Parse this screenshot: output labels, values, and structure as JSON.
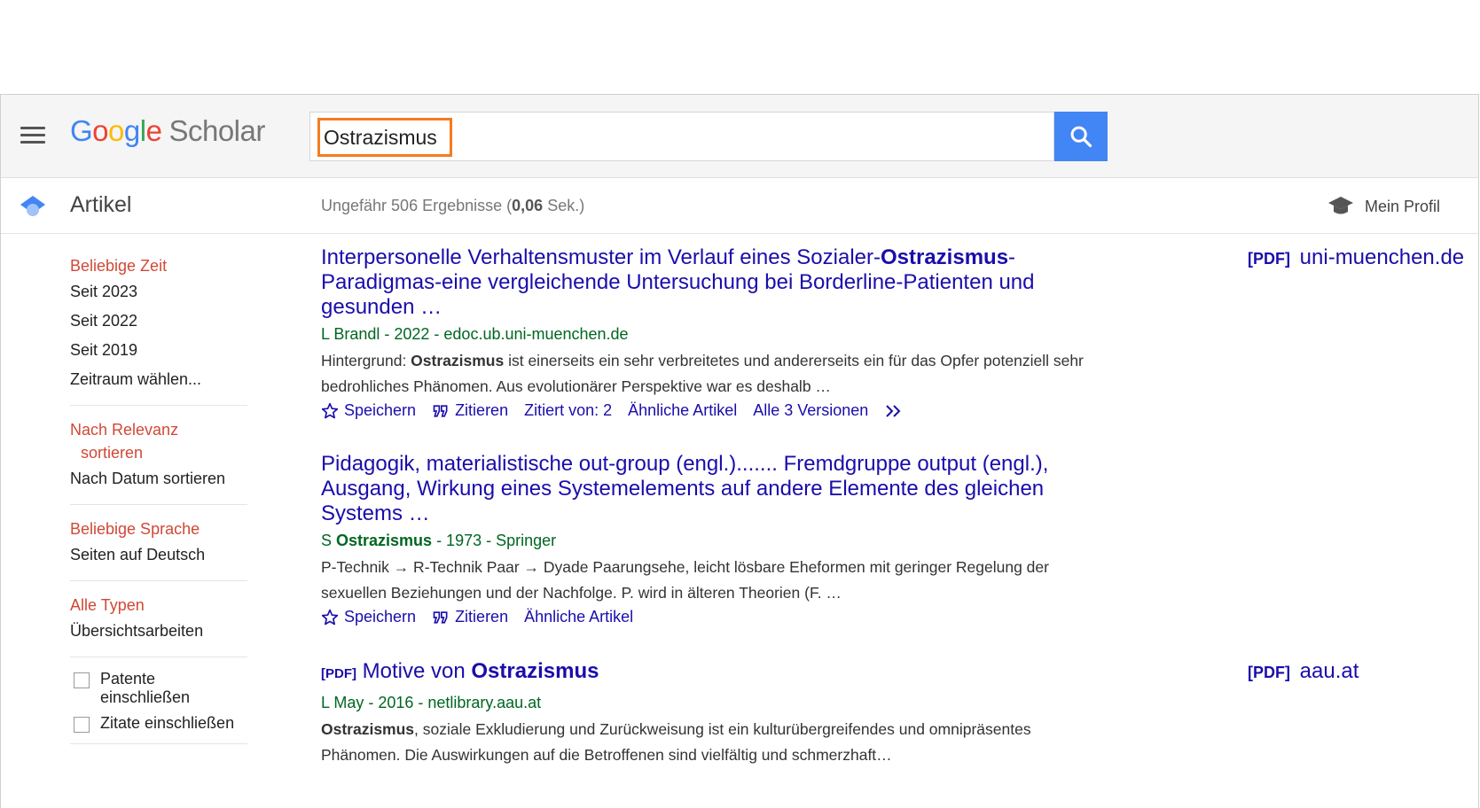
{
  "header": {
    "logo_google": [
      "G",
      "o",
      "o",
      "g",
      "l",
      "e"
    ],
    "logo_scholar": "Scholar",
    "search_value": "Ostrazismus"
  },
  "subbar": {
    "section_label": "Artikel",
    "results_prefix": "Ungefähr 506 Ergebnisse (",
    "results_time": "0,06",
    "results_suffix": " Sek.)",
    "profile_label": "Mein Profil"
  },
  "sidebar": {
    "time": [
      "Beliebige Zeit",
      "Seit 2023",
      "Seit 2022",
      "Seit 2019",
      "Zeitraum wählen..."
    ],
    "sort_active_1": "Nach Relevanz",
    "sort_active_2": "sortieren",
    "sort_other": "Nach Datum sortieren",
    "lang": [
      "Beliebige Sprache",
      "Seiten auf Deutsch"
    ],
    "types": [
      "Alle Typen",
      "Übersichtsarbeiten"
    ],
    "check_patents_1": "Patente",
    "check_patents_2": "einschließen",
    "check_citations": "Zitate einschließen"
  },
  "results": [
    {
      "title_pre": "Interpersonelle Verhaltensmuster im Verlauf eines Sozialer-",
      "title_bold": "Ostrazismus",
      "title_post": "-Paradigmas-eine vergleichende Untersuchung bei Borderline-Patienten und gesunden …",
      "meta": "L Brandl - 2022 - edoc.ub.uni-muenchen.de",
      "snippet_pre": "Hintergrund: ",
      "snippet_bold": "Ostrazismus",
      "snippet_post": " ist einerseits ein sehr verbreitetes und andererseits ein für das Opfer potenziell sehr bedrohliches Phänomen. Aus evolutionärer Perspektive war es deshalb …",
      "actions": [
        "Speichern",
        "Zitieren",
        "Zitiert von: 2",
        "Ähnliche Artikel",
        "Alle 3 Versionen"
      ],
      "side_tag": "[PDF]",
      "side_link": "uni-muenchen.de"
    },
    {
      "title": "Pidagogik, materialistische out-group (engl.)....... Fremdgruppe output (engl.), Ausgang, Wirkung eines Systemelements auf andere Elemente des gleichen Systems …",
      "meta_pre": "S ",
      "meta_bold": "Ostrazismus",
      "meta_post": " - 1973 - Springer",
      "snippet": "P-Technik → R-Technik Paar → Dyade Paarungsehe, leicht lösbare Eheformen mit geringer Regelung der sexuellen Beziehungen und der Nachfolge. P. wird in älteren Theorien (F. …",
      "actions": [
        "Speichern",
        "Zitieren",
        "Ähnliche Artikel"
      ]
    },
    {
      "tag": "[PDF]",
      "title_pre": "Motive von ",
      "title_bold": "Ostrazismus",
      "meta": "L May - 2016 - netlibrary.aau.at",
      "snippet_bold": "Ostrazismus",
      "snippet_post": ", soziale Exkludierung und Zurückweisung ist ein kulturübergreifendes und omnipräsentes Phänomen. Die Auswirkungen auf die Betroffenen sind vielfältig und schmerzhaft…",
      "side_tag": "[PDF]",
      "side_link": "aau.at"
    }
  ],
  "colors": {
    "link": "#1a0dab",
    "meta_green": "#006621",
    "active_red": "#d14836",
    "search_button": "#4285f4",
    "highlight_border": "#f47c20"
  }
}
